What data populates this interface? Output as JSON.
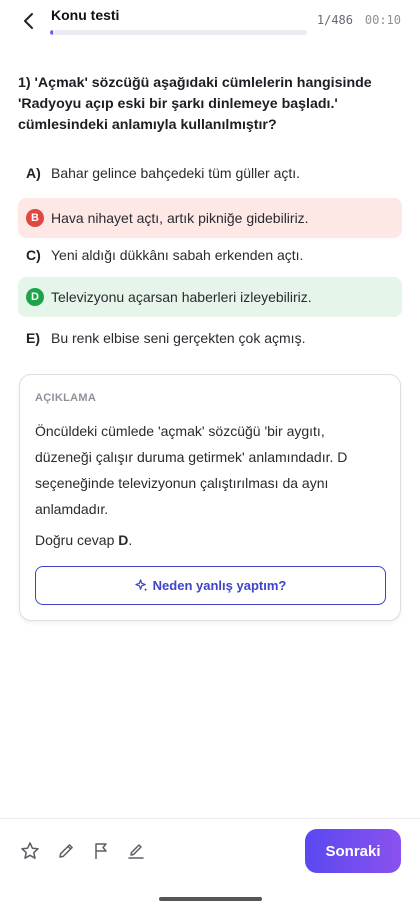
{
  "header": {
    "title": "Konu testi",
    "counter": "1/486",
    "timer": "00:10",
    "progress_fraction": 0.002
  },
  "question": {
    "text": "1) 'Açmak' sözcüğü aşağıdaki cümlelerin hangisinde 'Radyoyu açıp eski bir şarkı dinlemeye başladı.' cümlesindeki anlamıyla kullanılmıştır?"
  },
  "options": [
    {
      "letter": "A)",
      "text": "Bahar gelince bahçedeki tüm güller açtı.",
      "state": "neutral"
    },
    {
      "letter": "B",
      "text": "Hava nihayet açtı, artık pikniğe gidebiliriz.",
      "state": "wrong",
      "color": "#e0473f"
    },
    {
      "letter": "C)",
      "text": "Yeni aldığı dükkânı sabah erkenden açtı.",
      "state": "neutral"
    },
    {
      "letter": "D",
      "text": "Televizyonu açarsan haberleri izleyebiliriz.",
      "state": "correct",
      "color": "#1fa34a"
    },
    {
      "letter": "E)",
      "text": "Bu renk elbise seni gerçekten çok açmış.",
      "state": "neutral"
    }
  ],
  "explanation": {
    "heading": "AÇIKLAMA",
    "body": "Öncüldeki cümlede 'açmak' sözcüğü 'bir aygıtı, düzeneği çalışır duruma getirmek' anlamındadır. D seçeneğinde televizyonun çalıştırılması da aynı anlamdadır.",
    "answer_prefix": "Doğru cevap ",
    "answer_letter": "D",
    "answer_suffix": ".",
    "why_button_label": "Neden yanlış yaptım?",
    "why_button_icon": "sparkle-icon"
  },
  "toolbar": {
    "icons": [
      "star-icon",
      "pencil-icon",
      "flag-icon",
      "edit-note-icon"
    ],
    "next_label": "Sonraki"
  },
  "colors": {
    "accent": "#3f43c8",
    "wrong_bg": "#fde8e6",
    "correct_bg": "#e6f5ea",
    "next_gradient_start": "#5a48f0",
    "next_gradient_end": "#8a52ee"
  }
}
